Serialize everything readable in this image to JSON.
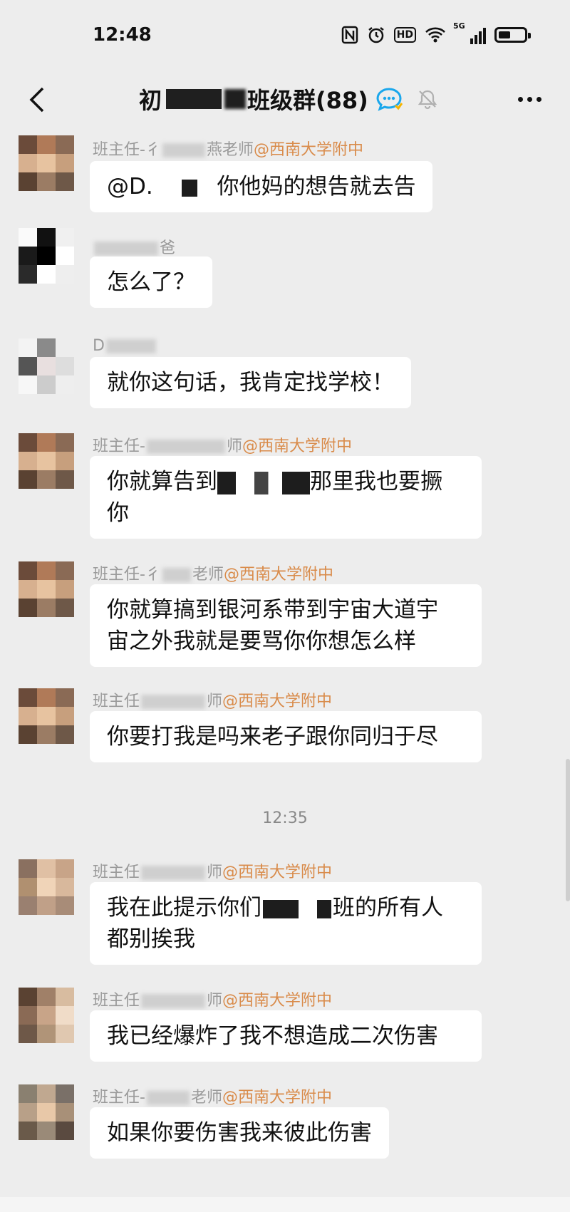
{
  "status": {
    "time": "12:48",
    "net_label": "5G",
    "hd_label": "HD"
  },
  "header": {
    "title_prefix": "初",
    "title_main": "班级群(88)",
    "back_icon": "chevron-left-icon",
    "more_icon": "more-dots-icon"
  },
  "messages": [
    {
      "sender_pre": "班主任-彳",
      "sender_post": "燕老师",
      "school": "@西南大学附中",
      "text_a": "@D.",
      "text_b": "你他妈的想告就去告"
    },
    {
      "sender_post": "爸",
      "text": "怎么了？"
    },
    {
      "sender_pre": "D",
      "text": "就你这句话，我肯定找学校！"
    },
    {
      "sender_pre": "班主任-",
      "sender_post": "师",
      "school": "@西南大学附中",
      "text_a": "你就算告到",
      "text_b": "那里我也要撅",
      "text_c": "你"
    },
    {
      "sender_pre": "班主任-彳",
      "sender_post": "老师",
      "school": "@西南大学附中",
      "line1": "你就算搞到银河系带到宇宙大道宇",
      "line2": "宙之外我就是要骂你你想怎么样"
    },
    {
      "sender_pre": "班主任",
      "sender_post": "师",
      "school": "@西南大学附中",
      "text": "你要打我是吗来老子跟你同归于尽"
    },
    {
      "sender_pre": "班主任",
      "sender_post": "师",
      "school": "@西南大学附中",
      "text_a": "我在此提示你们",
      "text_b": "班的所有人",
      "text_c": "都别挨我"
    },
    {
      "sender_pre": "班主任",
      "sender_post": "师",
      "school": "@西南大学附中",
      "text": "我已经爆炸了我不想造成二次伤害"
    },
    {
      "sender_pre": "班主任-",
      "sender_post": "老师",
      "school": "@西南大学附中",
      "text": "如果你要伤害我来彼此伤害"
    }
  ],
  "time_separator": "12:35"
}
